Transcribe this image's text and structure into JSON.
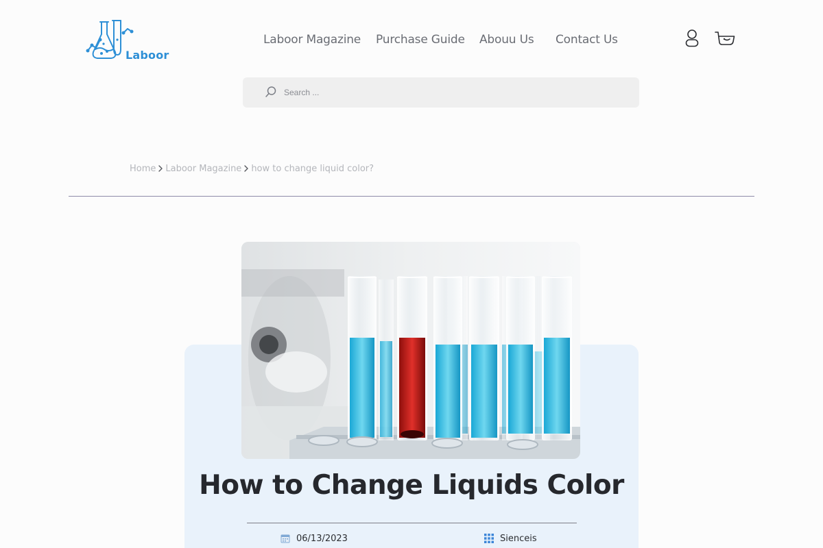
{
  "header": {
    "logo_text": "Laboor",
    "nav": [
      {
        "label": "Laboor Magazine"
      },
      {
        "label": "Purchase Guide"
      },
      {
        "label": "Abouu Us"
      },
      {
        "label": "Contact Us"
      }
    ],
    "icons": {
      "account": "user-icon",
      "cart": "cart-icon"
    }
  },
  "search": {
    "placeholder": "Search ...",
    "value": "",
    "icon": "search-icon"
  },
  "breadcrumb": {
    "items": [
      {
        "label": "Home"
      },
      {
        "label": "Laboor Magazine"
      },
      {
        "label": "how to change liquid color?"
      }
    ],
    "separator_icon": "chevron-right-icon"
  },
  "article": {
    "title": "How to Change Liquids Color",
    "date": "06/13/2023",
    "date_icon": "calendar-icon",
    "category": "Sienceis",
    "category_icon": "grid-icon",
    "image_description_icon": "test-tubes-image"
  },
  "colors": {
    "brand": "#2d8fd6",
    "nav_text": "#6a6d74",
    "card_bg": "#e9f2fb",
    "search_bg": "#efefef",
    "divider": "#8e8ba8",
    "title_text": "#26282d"
  }
}
